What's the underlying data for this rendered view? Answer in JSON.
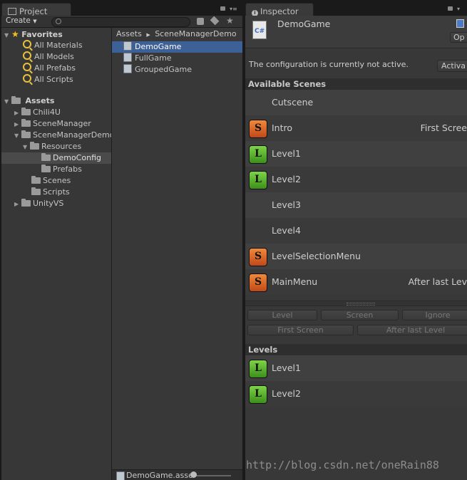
{
  "project_panel": {
    "tab_label": "Project",
    "create_label": "Create",
    "search_placeholder": "",
    "favorites": {
      "label": "Favorites",
      "items": [
        "All Materials",
        "All Models",
        "All Prefabs",
        "All Scripts"
      ]
    },
    "assets_label": "Assets",
    "tree": [
      {
        "label": "Chili4U",
        "depth": 1
      },
      {
        "label": "SceneManager",
        "depth": 1
      },
      {
        "label": "SceneManagerDemo",
        "depth": 1
      },
      {
        "label": "Resources",
        "depth": 2
      },
      {
        "label": "DemoConfig",
        "depth": 3
      },
      {
        "label": "Prefabs",
        "depth": 3
      },
      {
        "label": "Scenes",
        "depth": 2
      },
      {
        "label": "Scripts",
        "depth": 2
      },
      {
        "label": "UnityVS",
        "depth": 1
      }
    ],
    "breadcrumb": [
      "Assets",
      "SceneManagerDemo"
    ],
    "files": [
      "DemoGame",
      "FullGame",
      "GroupedGame"
    ],
    "status_file": "DemoGame.asset"
  },
  "inspector": {
    "tab_label": "Inspector",
    "object_name": "DemoGame",
    "open_label": "Op",
    "file_icon_text": "C#",
    "message": "The configuration is currently not active.",
    "activate_label": "Activa",
    "available_scenes_label": "Available Scenes",
    "scenes": [
      {
        "name": "Cutscene",
        "badge": "",
        "value": ""
      },
      {
        "name": "Intro",
        "badge": "S",
        "value": "First Scree"
      },
      {
        "name": "Level1",
        "badge": "L",
        "value": ""
      },
      {
        "name": "Level2",
        "badge": "L",
        "value": ""
      },
      {
        "name": "Level3",
        "badge": "",
        "value": ""
      },
      {
        "name": "Level4",
        "badge": "",
        "value": ""
      },
      {
        "name": "LevelSelectionMenu",
        "badge": "S",
        "value": ""
      },
      {
        "name": "MainMenu",
        "badge": "S",
        "value": "After last Lev"
      }
    ],
    "buttons_row1": [
      "Level",
      "Screen",
      "Ignore"
    ],
    "buttons_row2": [
      "First Screen",
      "After last Level"
    ],
    "levels_label": "Levels",
    "levels": [
      {
        "name": "Level1",
        "badge": "L"
      },
      {
        "name": "Level2",
        "badge": "L"
      }
    ]
  },
  "watermark": "http://blog.csdn.net/oneRain88",
  "colors": {
    "selection": "#3d6096",
    "badge_s": "#e06a2a",
    "badge_l": "#5bb234",
    "favorite_star": "#f0c020"
  }
}
